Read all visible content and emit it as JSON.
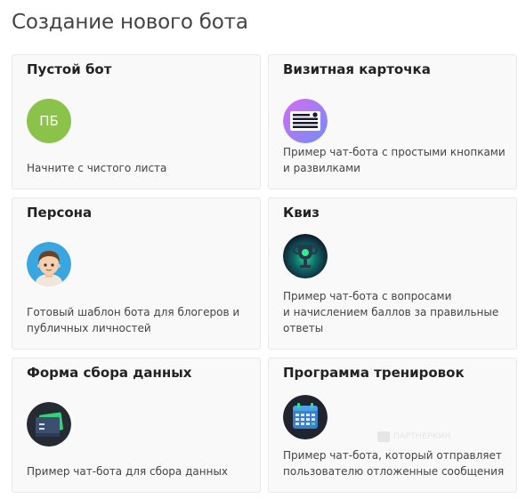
{
  "page": {
    "title": "Создание нового бота"
  },
  "cards": [
    {
      "title": "Пустой бот",
      "icon": "initials-avatar",
      "initials": "ПБ",
      "desc": [
        "Начните с чистого листа"
      ]
    },
    {
      "title": "Визитная карточка",
      "icon": "business-card-icon",
      "desc": [
        "Пример чат-бота с простыми кнопками",
        "и развилками"
      ]
    },
    {
      "title": "Персона",
      "icon": "persona-avatar-icon",
      "desc": [
        "Готовый шаблон бота для блогеров и",
        "публичных личностей"
      ]
    },
    {
      "title": "Квиз",
      "icon": "trophy-icon",
      "desc": [
        "Пример чат-бота с вопросами",
        "и начислением баллов за правильные",
        "ответы"
      ]
    },
    {
      "title": "Форма сбора данных",
      "icon": "form-icon",
      "desc": [
        "Пример чат-бота для сбора данных"
      ]
    },
    {
      "title": "Программа тренировок",
      "icon": "calendar-icon",
      "desc": [
        "Пример чат-бота, который отправляет",
        "пользователю отложенные сообщения"
      ]
    }
  ],
  "watermark": "ПАРТНЕРКИН",
  "colors": {
    "initials_bg": "#8bc34a",
    "card_bg": "#f9f9f9",
    "card_border": "#e8e8e8"
  }
}
